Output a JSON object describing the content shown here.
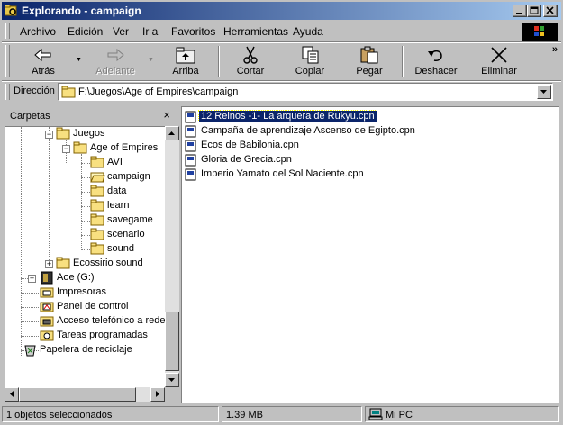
{
  "window": {
    "title": "Explorando - campaign"
  },
  "menu": [
    "Archivo",
    "Edición",
    "Ver",
    "Ir a",
    "Favoritos",
    "Herramientas",
    "Ayuda"
  ],
  "toolbar": {
    "back": "Atrás",
    "forward": "Adelante",
    "up": "Arriba",
    "cut": "Cortar",
    "copy": "Copiar",
    "paste": "Pegar",
    "undo": "Deshacer",
    "delete": "Eliminar",
    "more": "»"
  },
  "address": {
    "label": "Dirección",
    "path": "F:\\Juegos\\Age of Empires\\campaign"
  },
  "folders_pane": {
    "title": "Carpetas",
    "close": "×",
    "tree": [
      "Juegos",
      "Age of Empires",
      "AVI",
      "campaign",
      "data",
      "learn",
      "savegame",
      "scenario",
      "sound",
      "Ecossirio sound",
      "Aoe (G:)",
      "Impresoras",
      "Panel de control",
      "Acceso telefónico a redes",
      "Tareas programadas",
      "Papelera de reciclaje"
    ]
  },
  "files": [
    "12 Reinos -1- La arquera de Rukyu.cpn",
    "Campaña de aprendizaje Ascenso de Egipto.cpn",
    "Ecos de Babilonia.cpn",
    "Gloria de Grecia.cpn",
    "Imperio Yamato del Sol Naciente.cpn"
  ],
  "status": {
    "selected": "1 objetos seleccionados",
    "size": "1.39 MB",
    "zone": "Mi PC"
  },
  "colors": {
    "titlebar_start": "#0a246a",
    "titlebar_end": "#a6caf0",
    "face": "#c0c0c0",
    "selection": "#0a246a"
  }
}
